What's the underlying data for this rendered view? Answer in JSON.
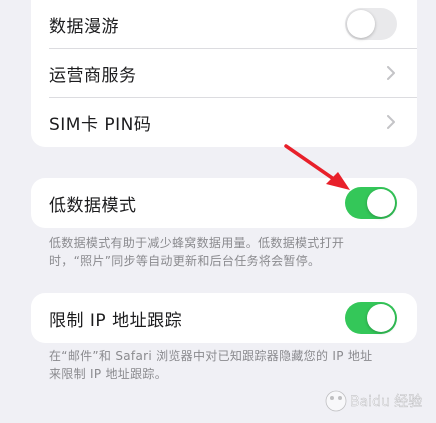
{
  "cellular_group": {
    "data_roaming": {
      "label": "数据漫游",
      "toggle_on": false
    },
    "carrier_services": {
      "label": "运营商服务"
    },
    "sim_pin": {
      "label": "SIM卡 PIN码"
    }
  },
  "low_data_mode": {
    "label": "低数据模式",
    "toggle_on": true,
    "footnote_line1": "低数据模式有助于减少蜂窝数据用量。低数据模式打开",
    "footnote_line2": "时，“照片”同步等自动更新和后台任务将会暂停。"
  },
  "limit_ip_tracking": {
    "label": "限制 IP 地址跟踪",
    "toggle_on": true,
    "footnote_line1": "在“邮件”和 Safari 浏览器中对已知跟踪器隐藏您的 IP 地址",
    "footnote_line2": "来限制 IP 地址跟踪。"
  },
  "watermark": {
    "text": "Baidu 经验"
  },
  "colors": {
    "toggle_on": "#34c759",
    "toggle_off": "#e9e9eb",
    "arrow": "#e8202a"
  }
}
